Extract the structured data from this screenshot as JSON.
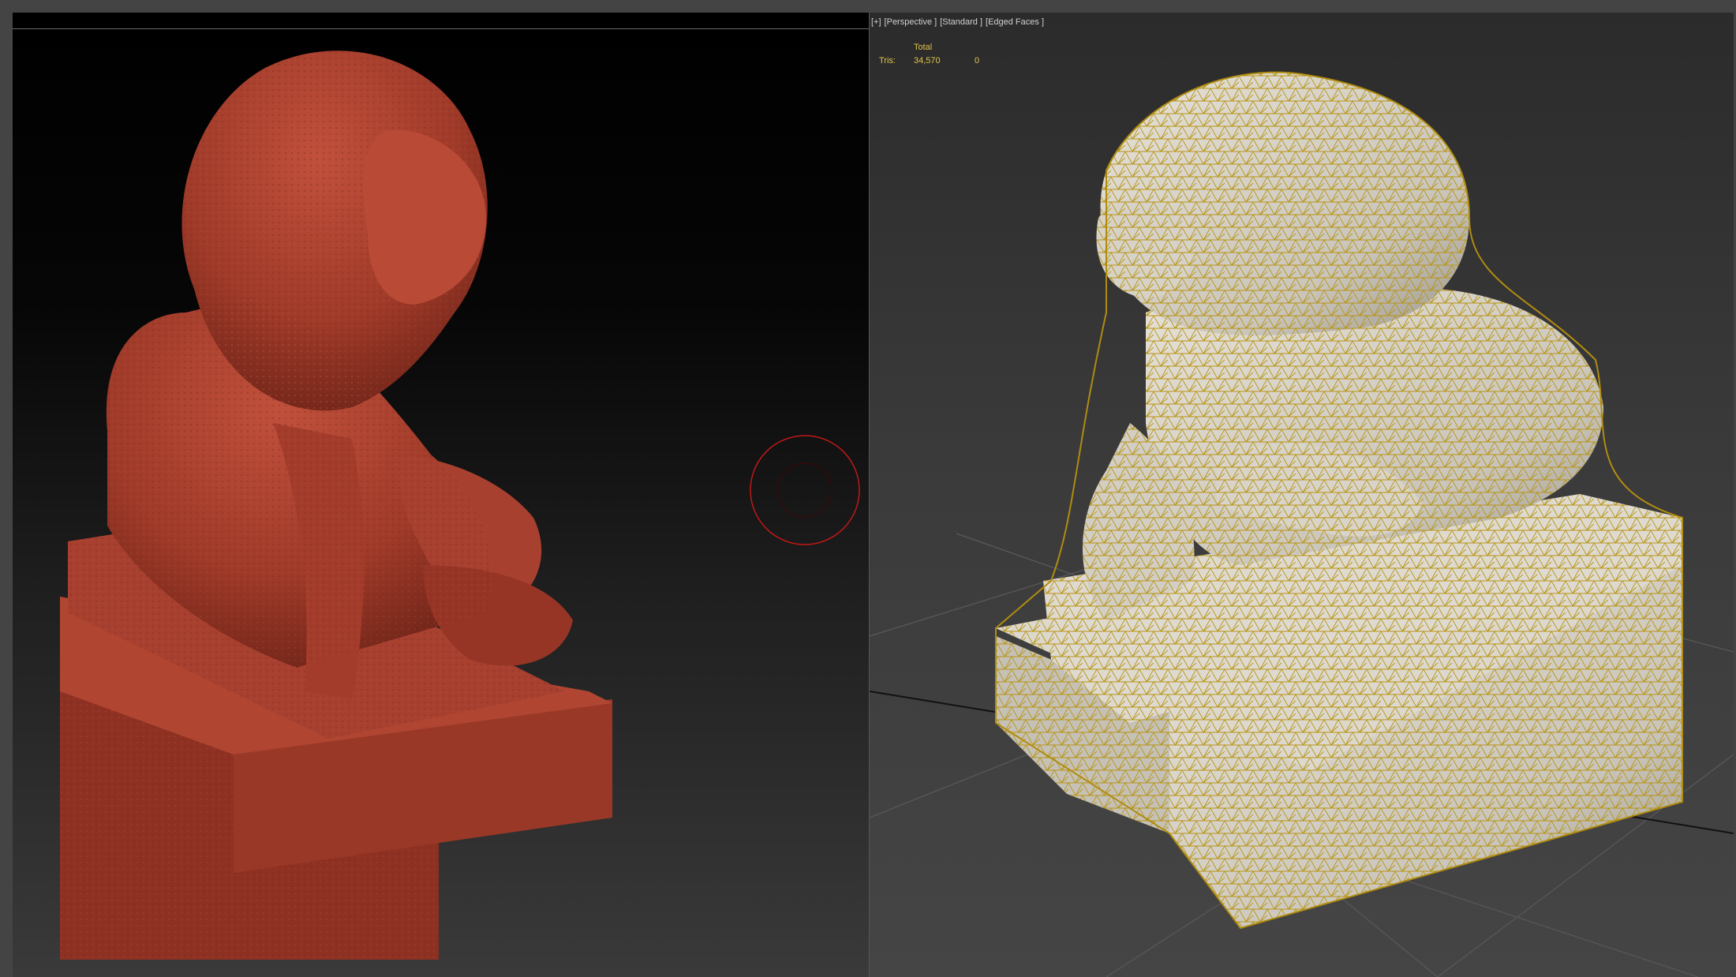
{
  "viewport_right": {
    "label_parts": [
      "[+]",
      "[Perspective ]",
      "[Standard ]",
      "[Edged Faces ]"
    ],
    "stats": {
      "total_label": "Total",
      "tris_label": "Tris:",
      "tris_total": "34,570",
      "tris_selected": "0"
    }
  },
  "colors": {
    "sculpt_clay": "#a8402e",
    "wire": "#c8a51c",
    "mesh_surface": "#d8d4cc",
    "brush_ring": "#c01818",
    "stats_text": "#e0c34a"
  }
}
